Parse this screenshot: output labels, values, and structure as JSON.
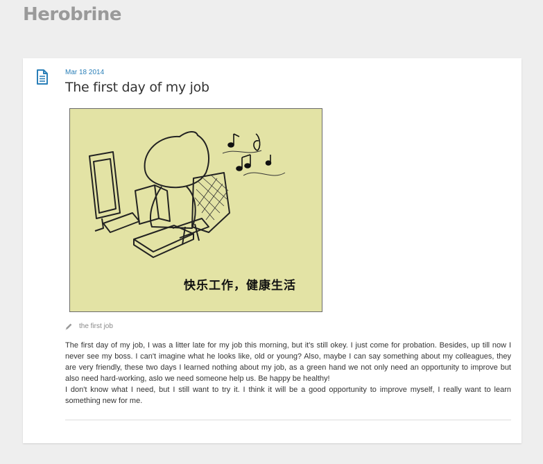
{
  "site": {
    "title": "Herobrine"
  },
  "post": {
    "icon": "document-icon",
    "date": "Mar 18 2014",
    "title": "The first day of my job",
    "image": {
      "caption_cn": "快乐工作，健康生活"
    },
    "tag": {
      "icon": "pencil-icon",
      "label": "the first job"
    },
    "paragraphs": [
      "The first day of my job, I was a litter late for my job this morning, but it's still okey. I just come for probation. Besides, up till now I never see my boss. I can't imagine what he looks like, old or young? Also, maybe I can say something about my colleagues, they are very friendly, these two days I learned nothing about my job, as a green hand we not only need an opportunity to improve but also need hard-working, aslo we need someone help us. Be happy be healthy!",
      "I don't know what I need, but I still want to try it. I think it will be a good opportunity to improve myself, I really want to learn something new for me."
    ]
  },
  "colors": {
    "background": "#eeeeee",
    "card": "#ffffff",
    "accent": "#2a7fb8",
    "image_bg": "#e3e3a5"
  }
}
